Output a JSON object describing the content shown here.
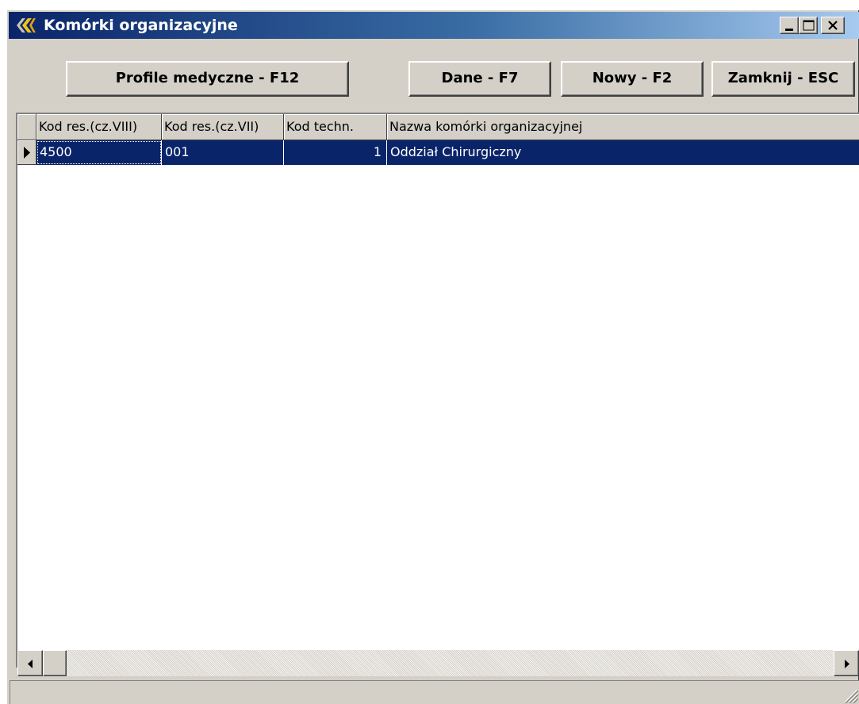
{
  "window": {
    "title": "Komórki organizacyjne",
    "title_bar_colors": [
      "#0a246a",
      "#a6caf0"
    ],
    "icons": {
      "app": "app-logo-icon",
      "minimize": "minimize-icon",
      "maximize": "maximize-icon",
      "close": "close-icon"
    }
  },
  "toolbar": {
    "profile_label": "Profile medyczne - F12",
    "dane_label": "Dane - F7",
    "nowy_label": "Nowy - F2",
    "zamknij_label": "Zamknij - ESC"
  },
  "grid": {
    "columns": [
      "Kod res.(cz.VIII)",
      "Kod res.(cz.VII)",
      "Kod techn.",
      "Nazwa komórki organizacyjnej"
    ],
    "rows": [
      {
        "selected": true,
        "cells": [
          "4500",
          "001",
          "1",
          "Oddział Chirurgiczny"
        ]
      }
    ],
    "selection_color": "#0a246a",
    "row_indicator_icon": "current-row-arrow-icon"
  },
  "hscroll": {
    "left_icon": "scroll-left-arrow-icon",
    "right_icon": "scroll-right-arrow-icon",
    "position": 0
  },
  "statusbar": {
    "text": "",
    "grip_icon": "size-grip-icon"
  }
}
